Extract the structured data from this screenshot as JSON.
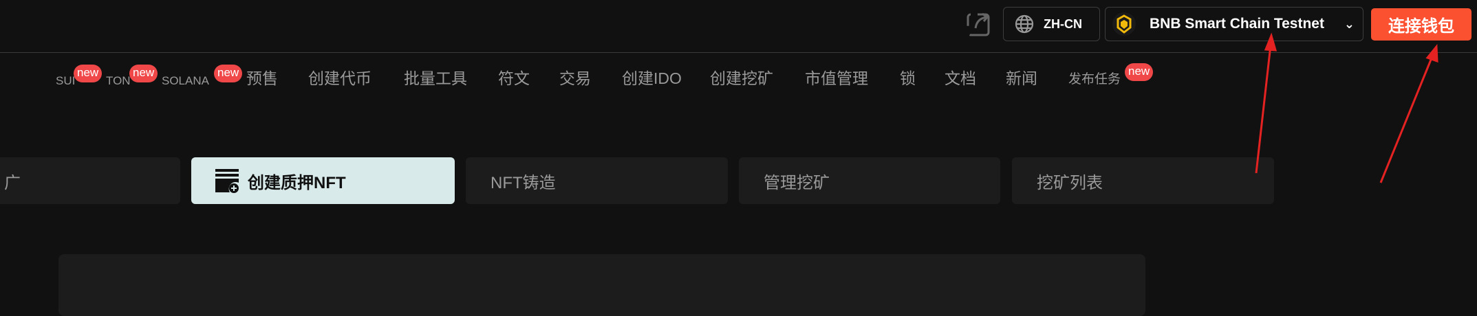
{
  "header": {
    "language": "ZH-CN",
    "chain": "BNB Smart Chain Testnet",
    "connect_label": "连接钱包",
    "accent": "#fc5130"
  },
  "nav": {
    "items": [
      {
        "label": "SUI",
        "badge": "new"
      },
      {
        "label": "TON",
        "badge": "new"
      },
      {
        "label": "SOLANA",
        "badge": "new"
      },
      {
        "label": "预售"
      },
      {
        "label": "创建代币"
      },
      {
        "label": "批量工具"
      },
      {
        "label": "符文"
      },
      {
        "label": "交易"
      },
      {
        "label": "创建IDO"
      },
      {
        "label": "创建挖矿"
      },
      {
        "label": "市值管理"
      },
      {
        "label": "锁"
      },
      {
        "label": "文档"
      },
      {
        "label": "新闻"
      },
      {
        "label": "发布任务",
        "badge": "new"
      }
    ]
  },
  "tabs": [
    {
      "label": "广"
    },
    {
      "label": "创建质押NFT",
      "active": true
    },
    {
      "label": "NFT铸造"
    },
    {
      "label": "管理挖矿"
    },
    {
      "label": "挖矿列表"
    }
  ]
}
